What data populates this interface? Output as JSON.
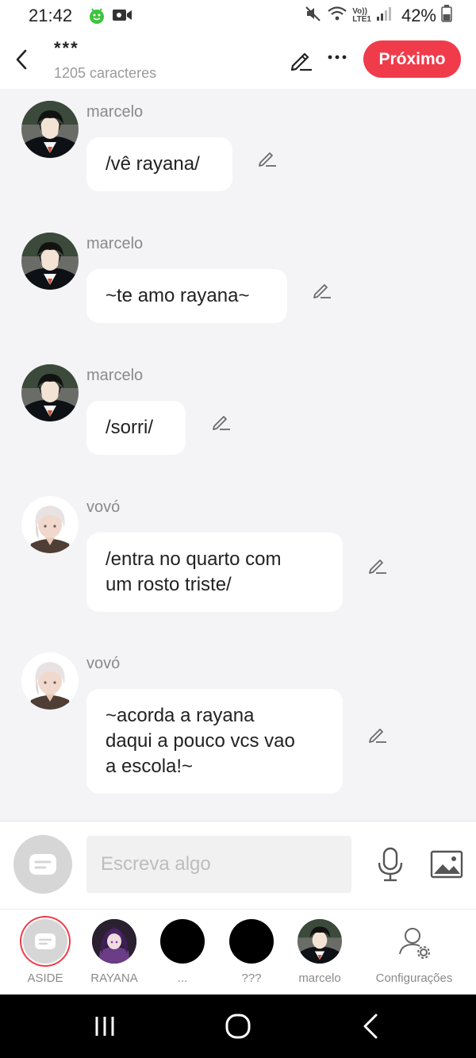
{
  "status_bar": {
    "time": "21:42",
    "battery": "42%",
    "icons": [
      "android-icon",
      "video-icon",
      "mute-icon",
      "wifi-icon",
      "volte-icon",
      "signal-icon",
      "battery-icon"
    ],
    "network_label_1": "Vo))",
    "network_label_2": "LTE1"
  },
  "header": {
    "title": "***",
    "char_count": "1205 caracteres",
    "next_label": "Próximo",
    "accent": "#f03b4b"
  },
  "messages": [
    {
      "sender": "marcelo",
      "lines": [
        "/vê rayana/"
      ]
    },
    {
      "sender": "marcelo",
      "lines": [
        "~te amo rayana~"
      ]
    },
    {
      "sender": "marcelo",
      "lines": [
        "/sorri/"
      ]
    },
    {
      "sender": "vovó",
      "lines": [
        "/entra no quarto com",
        "um rosto triste/"
      ]
    },
    {
      "sender": "vovó",
      "lines": [
        "~acorda a rayana",
        "daqui a pouco vcs vao",
        "a escola!~"
      ]
    }
  ],
  "input": {
    "placeholder": "Escreva algo",
    "value": ""
  },
  "character_bar": {
    "items": [
      {
        "label": "ASIDE"
      },
      {
        "label": "RAYANA"
      },
      {
        "label": "..."
      },
      {
        "label": "???"
      },
      {
        "label": "marcelo"
      },
      {
        "label": "Configurações"
      }
    ]
  }
}
